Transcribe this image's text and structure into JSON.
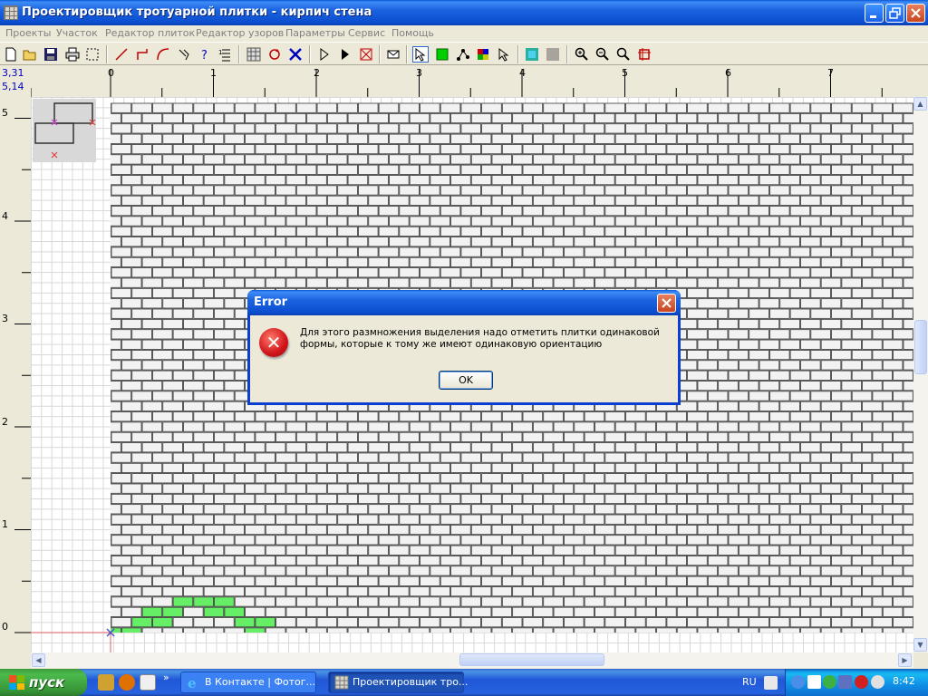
{
  "window": {
    "title": "Проектировщик тротуарной плитки - кирпич стена"
  },
  "menu": [
    "Проекты",
    "Участок",
    "Редактор плиток",
    "Редактор узоров",
    "Параметры",
    "Сервис",
    "Помощь"
  ],
  "coords": {
    "x": "3,31",
    "y": "5,14"
  },
  "ruler": {
    "horizontal": [
      "0",
      "1",
      "2",
      "3",
      "4",
      "5",
      "6",
      "7"
    ],
    "vertical": [
      "5",
      "4",
      "3",
      "2",
      "1",
      "0"
    ]
  },
  "dialog": {
    "title": "Error",
    "message": "Для этого размножения выделения надо отметить плитки одинаковой формы, которые к тому же имеют одинаковую ориентацию",
    "ok_label": "OK"
  },
  "taskbar": {
    "start_label": "пуск",
    "tasks": [
      {
        "label": "В Контакте | Фотог..."
      },
      {
        "label": "Проектировщик тро..."
      }
    ],
    "chevron": "»",
    "language": "RU",
    "clock": "8:42"
  },
  "colors": {
    "selection_green": "#66ee66",
    "brick_fill": "#f2f2f2",
    "brick_mortar": "#333333",
    "titlebar_blue": "#0b4fd0",
    "error_red": "#d0141a"
  }
}
